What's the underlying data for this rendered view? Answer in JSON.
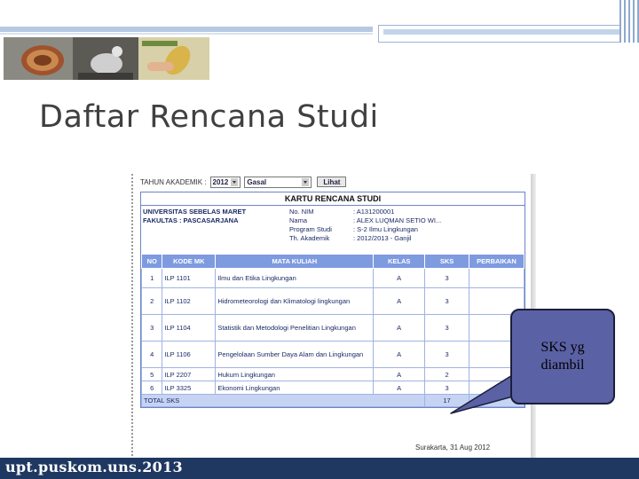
{
  "slide": {
    "title": "Daftar Rencana Studi",
    "footer": "upt.puskom.uns.2013",
    "photos": [
      "shell-photo",
      "bird-photo",
      "hand-plant-photo"
    ]
  },
  "form": {
    "tahun_label": "TAHUN AKADEMIK :",
    "year_value": "2012",
    "semester_value": "Gasal",
    "lihat_label": "Lihat"
  },
  "krs": {
    "title": "KARTU RENCANA STUDI",
    "university": "UNIVERSITAS SEBELAS MARET",
    "faculty": "FAKULTAS : PASCASARJANA",
    "fields": [
      {
        "label": "No. NIM",
        "value": ": A131200001"
      },
      {
        "label": "Nama",
        "value": ": ALEX LUQMAN SETIO WI..."
      },
      {
        "label": "Program Studi",
        "value": ": S-2 Ilmu Lingkungan"
      },
      {
        "label": "Th. Akademik",
        "value": ": 2012/2013 - Ganjil"
      }
    ],
    "headers": {
      "no": "NO",
      "kode": "KODE MK",
      "mk": "MATA KULIAH",
      "kelas": "KELAS",
      "sks": "SKS",
      "perbaikan": "PERBAIKAN"
    },
    "rows": [
      {
        "no": "1",
        "kode": "ILP 1101",
        "mk": "Ilmu dan Etika Lingkungan",
        "kelas": "A",
        "sks": "3",
        "perbaikan": ""
      },
      {
        "no": "2",
        "kode": "ILP 1102",
        "mk": "Hidrometeorologi dan Klimatologi lingkungan",
        "kelas": "A",
        "sks": "3",
        "perbaikan": ""
      },
      {
        "no": "3",
        "kode": "ILP 1104",
        "mk": "Statistik dan Metodologi Penelitian Lingkungan",
        "kelas": "A",
        "sks": "3",
        "perbaikan": ""
      },
      {
        "no": "4",
        "kode": "ILP 1106",
        "mk": "Pengelolaan Sumber Daya Alam dan Lingkungan",
        "kelas": "A",
        "sks": "3",
        "perbaikan": ""
      },
      {
        "no": "5",
        "kode": "ILP 2207",
        "mk": "Hukum Lingkungan",
        "kelas": "A",
        "sks": "2",
        "perbaikan": ""
      },
      {
        "no": "6",
        "kode": "ILP 3325",
        "mk": "Ekonomi Lingkungan",
        "kelas": "A",
        "sks": "3",
        "perbaikan": ""
      }
    ],
    "total_label": "TOTAL SKS",
    "total_value": "17",
    "place_date": "Surakarta, 31 Aug 2012"
  },
  "callout": {
    "line1": "SKS yg",
    "line2": "diambil"
  },
  "colors": {
    "footer": "#1f3862",
    "callout_fill": "#5b61a5",
    "table_header": "#7e9be0",
    "deco_blue": "#a8bfdc"
  }
}
